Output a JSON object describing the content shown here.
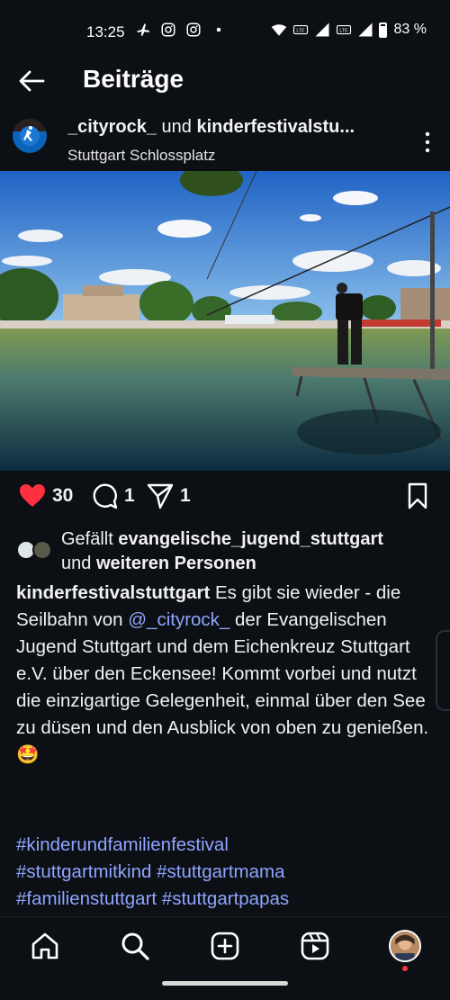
{
  "status_bar": {
    "time": "13:25",
    "battery": "83 %",
    "left_icons": [
      "airplane-icon",
      "instagram-icon",
      "instagram-icon",
      "dot-icon"
    ],
    "right_icons": [
      "wifi-icon",
      "volte-icon",
      "signal-icon",
      "volte-icon",
      "signal-icon",
      "battery-icon"
    ]
  },
  "header": {
    "title": "Beiträge",
    "back_icon": "arrow-left-icon"
  },
  "post": {
    "author_1": "_cityrock_",
    "connector": " und ",
    "author_2": "kinderfestivalstu...",
    "location": "Stuttgart Schlossplatz",
    "more_icon": "vertical-dots-icon",
    "photo_description": "photo",
    "likes_count": "30",
    "comments_count": "1",
    "shares_count": "1",
    "liked_by_prefix": "Gefällt ",
    "liked_by_user": "evangelische_jugend_stuttgart",
    "liked_by_mid": "und ",
    "liked_by_suffix": "weiteren Personen",
    "caption_user": "kinderfestivalstuttgart",
    "caption_part1": " Es gibt sie wieder - die Seilbahn von ",
    "caption_mention": "@_cityrock_",
    "caption_part2": " der Evangelischen Jugend Stuttgart und dem Eichenkreuz Stuttgart e.V. über den Eckensee! Kommt vorbei und nutzt die einzigartige Gelegenheit, einmal über den See zu düsen und den Ausblick von oben zu genießen.🤩",
    "hashtags_line1": "#kinderundfamilienfestival",
    "hashtags_line2": "#stuttgartmitkind #stuttgartmama",
    "hashtags_line3": "#familienstuttgart #stuttgartpapas"
  },
  "bottom_nav": {
    "items": [
      "home-icon",
      "search-icon",
      "create-icon",
      "reels-icon",
      "profile-avatar"
    ]
  },
  "colors": {
    "background": "#0c0f14",
    "like_red": "#ff3040",
    "link_blue": "#8fa5ff"
  }
}
